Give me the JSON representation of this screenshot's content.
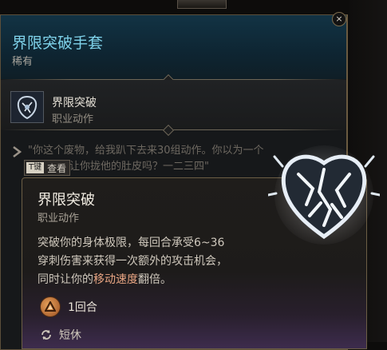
{
  "item": {
    "name": "界限突破手套",
    "rarity": "稀有"
  },
  "action": {
    "name": "界限突破",
    "type": "职业动作"
  },
  "flavor_text": "\"你这个废物，给我趴下去来30组动作。你以为一个\n人能地上让你拢他的肚皮吗？一二三四\"",
  "key_hint": {
    "key": "T键",
    "label": "查看"
  },
  "tooltip": {
    "title": "界限突破",
    "type": "职业动作",
    "desc_1": "突破你的身体极限，每回合承受6~36",
    "desc_2": "穿刺伤害",
    "desc_3": "来获得一次额外的攻击机会，",
    "desc_4": "同时让你的",
    "desc_5": "移动速度",
    "desc_6": "翻倍。",
    "cost_label": "1回合",
    "rest_label": "短休"
  },
  "close_glyph": "×",
  "colors": {
    "title": "#7fd2ea",
    "highlight": "#e8a583",
    "rarity": "#a7a49c"
  }
}
